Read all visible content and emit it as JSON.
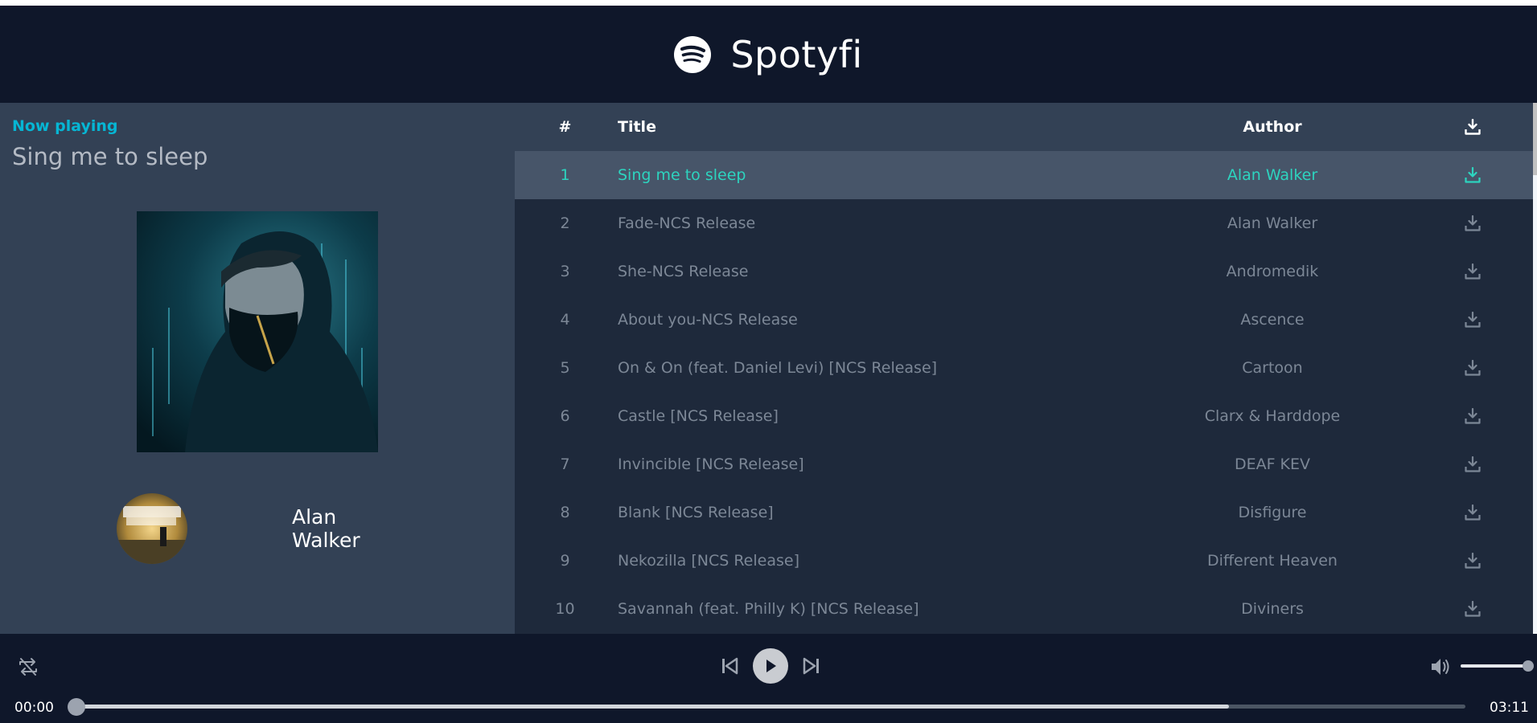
{
  "header": {
    "app_title": "Spotyfi",
    "logo_icon": "spotify-logo-icon"
  },
  "now_playing": {
    "label": "Now playing",
    "title": "Sing me to sleep",
    "artist": "Alan Walker"
  },
  "table": {
    "headers": {
      "num": "#",
      "title": "Title",
      "author": "Author",
      "download_icon": "download-icon"
    },
    "active_index": 0,
    "rows": [
      {
        "num": "1",
        "title": "Sing me to sleep",
        "author": "Alan Walker"
      },
      {
        "num": "2",
        "title": "Fade-NCS Release",
        "author": "Alan Walker"
      },
      {
        "num": "3",
        "title": "She-NCS Release",
        "author": "Andromedik"
      },
      {
        "num": "4",
        "title": "About you-NCS Release",
        "author": "Ascence"
      },
      {
        "num": "5",
        "title": "On & On (feat. Daniel Levi) [NCS Release]",
        "author": "Cartoon"
      },
      {
        "num": "6",
        "title": "Castle [NCS Release]",
        "author": "Clarx & Harddope"
      },
      {
        "num": "7",
        "title": "Invincible [NCS Release]",
        "author": "DEAF KEV"
      },
      {
        "num": "8",
        "title": "Blank [NCS Release]",
        "author": "Disfigure"
      },
      {
        "num": "9",
        "title": "Nekozilla [NCS Release]",
        "author": "Different Heaven"
      },
      {
        "num": "10",
        "title": "Savannah (feat. Philly K) [NCS Release]",
        "author": "Diviners"
      }
    ]
  },
  "player": {
    "current_time": "00:00",
    "total_time": "03:11",
    "progress": 0.0,
    "buffered": 0.83,
    "volume": 1.0,
    "icons": [
      "repeat-off-icon",
      "previous-icon",
      "play-icon",
      "next-icon",
      "volume-icon"
    ]
  },
  "colors": {
    "accent": "#06b6d4",
    "active_text": "#2dd4bf",
    "header_bg": "#0f172a",
    "panel_bg": "#334155",
    "table_bg": "#1e293b",
    "active_row_bg": "#475569"
  }
}
